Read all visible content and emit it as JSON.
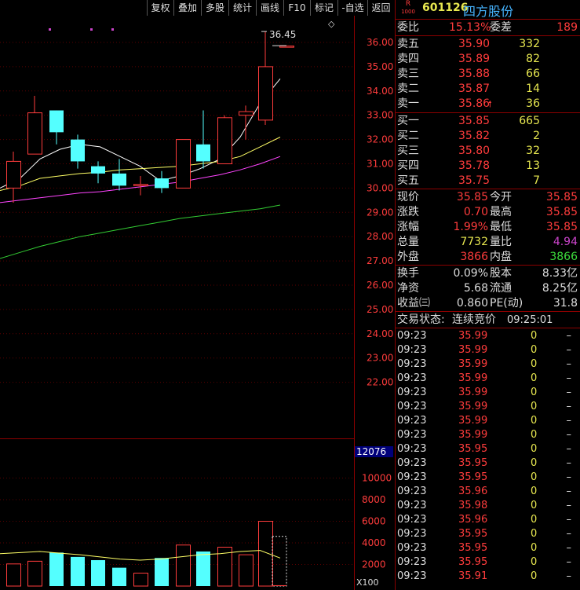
{
  "toolbar": {
    "items": [
      "复权",
      "叠加",
      "多股",
      "统计",
      "画线",
      "F10",
      "标记",
      "-自选",
      "返回"
    ]
  },
  "chart": {
    "diamond": "◇",
    "last_price_tag": "36.45",
    "price_ticks": [
      "36.00",
      "35.00",
      "34.00",
      "33.00",
      "32.00",
      "31.00",
      "30.00",
      "29.00",
      "28.00",
      "27.00",
      "26.00",
      "25.00",
      "24.00",
      "23.00",
      "22.00"
    ],
    "volume_max_label": "12076",
    "volume_ticks": [
      "10000",
      "8000",
      "6000",
      "4000",
      "2000"
    ],
    "volume_unit": "X100",
    "colors": {
      "up": "#ff3c3c",
      "down": "#54ffff",
      "ma5": "#ffffff",
      "ma10": "#ffff66",
      "ma20": "#ff44ff",
      "ma60": "#33cc33"
    },
    "candles": [
      {
        "o": 30.0,
        "c": 31.1,
        "h": 31.5,
        "l": 29.4,
        "v": 2050
      },
      {
        "o": 31.4,
        "c": 33.1,
        "h": 33.8,
        "l": 31.4,
        "v": 2300
      },
      {
        "o": 33.2,
        "c": 32.3,
        "h": 33.2,
        "l": 31.8,
        "v": 3100
      },
      {
        "o": 32.0,
        "c": 31.1,
        "h": 32.2,
        "l": 30.8,
        "v": 2700
      },
      {
        "o": 30.9,
        "c": 30.6,
        "h": 31.1,
        "l": 30.2,
        "v": 2400
      },
      {
        "o": 30.6,
        "c": 30.1,
        "h": 31.2,
        "l": 29.9,
        "v": 1700
      },
      {
        "o": 30.1,
        "c": 30.15,
        "h": 30.5,
        "l": 29.7,
        "v": 1200
      },
      {
        "o": 30.4,
        "c": 30.0,
        "h": 30.7,
        "l": 29.8,
        "v": 2600
      },
      {
        "o": 30.0,
        "c": 32.0,
        "h": 32.0,
        "l": 30.0,
        "v": 3800
      },
      {
        "o": 31.8,
        "c": 31.1,
        "h": 33.2,
        "l": 30.8,
        "v": 3200
      },
      {
        "o": 31.0,
        "c": 32.9,
        "h": 33.0,
        "l": 31.0,
        "v": 3600
      },
      {
        "o": 33.0,
        "c": 33.15,
        "h": 33.4,
        "l": 32.0,
        "v": 2900
      },
      {
        "o": 32.8,
        "c": 35.0,
        "h": 36.45,
        "l": 32.6,
        "v": 6000
      },
      {
        "o": 35.85,
        "c": 35.85,
        "h": 35.85,
        "l": 35.85,
        "v": 77
      }
    ],
    "ma5": [
      30.0,
      30.4,
      31.2,
      31.6,
      31.8,
      31.7,
      31.3,
      30.9,
      30.3,
      30.5,
      30.8,
      31.2,
      32.1,
      33.5,
      34.5
    ],
    "ma10": [
      29.9,
      30.1,
      30.4,
      30.5,
      30.6,
      30.65,
      30.75,
      30.8,
      30.85,
      30.9,
      31.0,
      31.1,
      31.3,
      31.7,
      32.1
    ],
    "ma20": [
      29.4,
      29.5,
      29.6,
      29.7,
      29.8,
      29.85,
      29.95,
      30.05,
      30.15,
      30.25,
      30.4,
      30.55,
      30.75,
      31.0,
      31.3
    ],
    "ma60": [
      27.1,
      27.35,
      27.6,
      27.8,
      28.0,
      28.15,
      28.3,
      28.45,
      28.6,
      28.75,
      28.85,
      28.95,
      29.05,
      29.15,
      29.3
    ],
    "vol_ma": [
      3000,
      3100,
      3200,
      3050,
      2900,
      2700,
      2500,
      2400,
      2500,
      2700,
      2900,
      3000,
      3200,
      3300,
      2600
    ]
  },
  "header": {
    "badge_r": "R",
    "badge_num": "1000",
    "code": "601126",
    "name": "四方股份"
  },
  "quote": {
    "weibi_label": "委比",
    "weibi": "15.13%",
    "weicha_label": "委差",
    "weicha": "189",
    "asks": [
      {
        "label": "卖五",
        "price": "35.90",
        "vol": "332"
      },
      {
        "label": "卖四",
        "price": "35.89",
        "vol": "82"
      },
      {
        "label": "卖三",
        "price": "35.88",
        "vol": "66"
      },
      {
        "label": "卖二",
        "price": "35.87",
        "vol": "14"
      },
      {
        "label": "卖一",
        "price": "35.86",
        "vol": "36",
        "arrow": "🠕"
      }
    ],
    "bids": [
      {
        "label": "买一",
        "price": "35.85",
        "vol": "665"
      },
      {
        "label": "买二",
        "price": "35.82",
        "vol": "2"
      },
      {
        "label": "买三",
        "price": "35.80",
        "vol": "32"
      },
      {
        "label": "买四",
        "price": "35.78",
        "vol": "13"
      },
      {
        "label": "买五",
        "price": "35.75",
        "vol": "7"
      }
    ],
    "stats": {
      "xianjia_label": "现价",
      "xianjia": "35.85",
      "jinkai_label": "今开",
      "jinkai": "35.85",
      "zhangdie_label": "涨跌",
      "zhangdie": "0.70",
      "zuigao_label": "最高",
      "zuigao": "35.85",
      "zhangfu_label": "涨幅",
      "zhangfu": "1.99%",
      "zuidi_label": "最低",
      "zuidi": "35.85",
      "zongliang_label": "总量",
      "zongliang": "7732",
      "liangbi_label": "量比",
      "liangbi": "4.94",
      "waipan_label": "外盘",
      "waipan": "3866",
      "neipan_label": "内盘",
      "neipan": "3866"
    },
    "fin": {
      "huanshou_label": "换手",
      "huanshou": "0.09%",
      "guben_label": "股本",
      "guben": "8.33亿",
      "jingzi_label": "净资",
      "jingzi": "5.68",
      "liutong_label": "流通",
      "liutong": "8.25亿",
      "shouyi_label": "收益㈢",
      "shouyi": "0.860",
      "pe_label": "PE(动)",
      "pe": "31.8"
    },
    "status_label": "交易状态:",
    "status": "连续竞价",
    "status_time": "09:25:01"
  },
  "ticks": [
    {
      "t": "09:23",
      "p": "35.99",
      "v": "0",
      "d": "–"
    },
    {
      "t": "09:23",
      "p": "35.99",
      "v": "0",
      "d": "–"
    },
    {
      "t": "09:23",
      "p": "35.99",
      "v": "0",
      "d": "–"
    },
    {
      "t": "09:23",
      "p": "35.99",
      "v": "0",
      "d": "–"
    },
    {
      "t": "09:23",
      "p": "35.99",
      "v": "0",
      "d": "–"
    },
    {
      "t": "09:23",
      "p": "35.99",
      "v": "0",
      "d": "–"
    },
    {
      "t": "09:23",
      "p": "35.99",
      "v": "0",
      "d": "–"
    },
    {
      "t": "09:23",
      "p": "35.99",
      "v": "0",
      "d": "–"
    },
    {
      "t": "09:23",
      "p": "35.95",
      "v": "0",
      "d": "–"
    },
    {
      "t": "09:23",
      "p": "35.95",
      "v": "0",
      "d": "–"
    },
    {
      "t": "09:23",
      "p": "35.95",
      "v": "0",
      "d": "–"
    },
    {
      "t": "09:23",
      "p": "35.96",
      "v": "0",
      "d": "–"
    },
    {
      "t": "09:23",
      "p": "35.98",
      "v": "0",
      "d": "–"
    },
    {
      "t": "09:23",
      "p": "35.96",
      "v": "0",
      "d": "–"
    },
    {
      "t": "09:23",
      "p": "35.95",
      "v": "0",
      "d": "–"
    },
    {
      "t": "09:23",
      "p": "35.95",
      "v": "0",
      "d": "–"
    },
    {
      "t": "09:23",
      "p": "35.95",
      "v": "0",
      "d": "–"
    },
    {
      "t": "09:23",
      "p": "35.91",
      "v": "0",
      "d": "–"
    }
  ]
}
